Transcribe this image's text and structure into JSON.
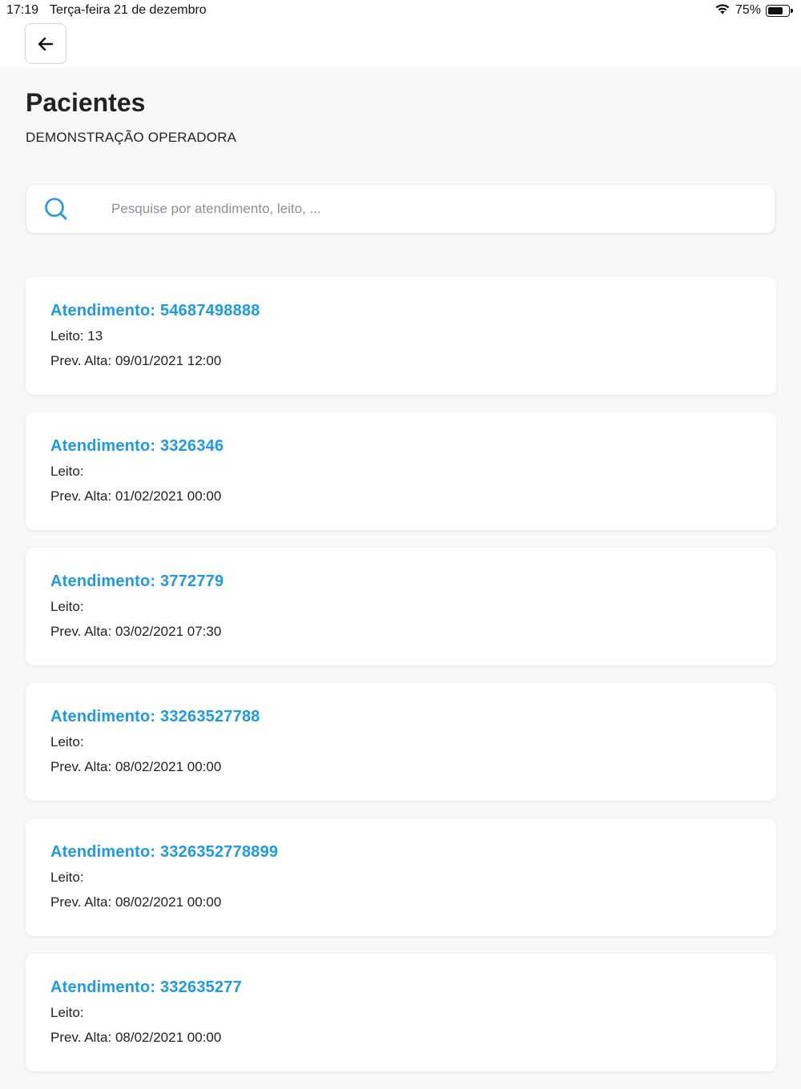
{
  "status_bar": {
    "time": "17:19",
    "date": "Terça-feira 21 de dezembro",
    "battery": "75%",
    "battery_level": 0.75,
    "wifi_icon": "wifi-icon",
    "battery_icon": "battery-icon"
  },
  "nav": {
    "back_icon": "arrow-left-icon"
  },
  "header": {
    "title": "Pacientes",
    "subtitle": "DEMONSTRAÇÃO OPERADORA"
  },
  "search": {
    "placeholder": "Pesquise por atendimento, leito, ...",
    "value": "",
    "icon": "search-icon"
  },
  "patients": [
    {
      "title": "Atendimento: 54687498888",
      "leito": "Leito: 13",
      "prev_alta": "Prev. Alta: 09/01/2021 12:00"
    },
    {
      "title": "Atendimento: 3326346",
      "leito": "Leito:",
      "prev_alta": "Prev. Alta: 01/02/2021 00:00"
    },
    {
      "title": "Atendimento: 3772779",
      "leito": "Leito:",
      "prev_alta": "Prev. Alta: 03/02/2021 07:30"
    },
    {
      "title": "Atendimento: 33263527788",
      "leito": "Leito:",
      "prev_alta": "Prev. Alta: 08/02/2021 00:00"
    },
    {
      "title": "Atendimento: 3326352778899",
      "leito": "Leito:",
      "prev_alta": "Prev. Alta: 08/02/2021 00:00"
    },
    {
      "title": "Atendimento: 332635277",
      "leito": "Leito:",
      "prev_alta": "Prev. Alta: 08/02/2021 00:00"
    }
  ],
  "colors": {
    "accent": "#1f9ae0",
    "background": "#f8f8f8",
    "card": "#ffffff"
  }
}
